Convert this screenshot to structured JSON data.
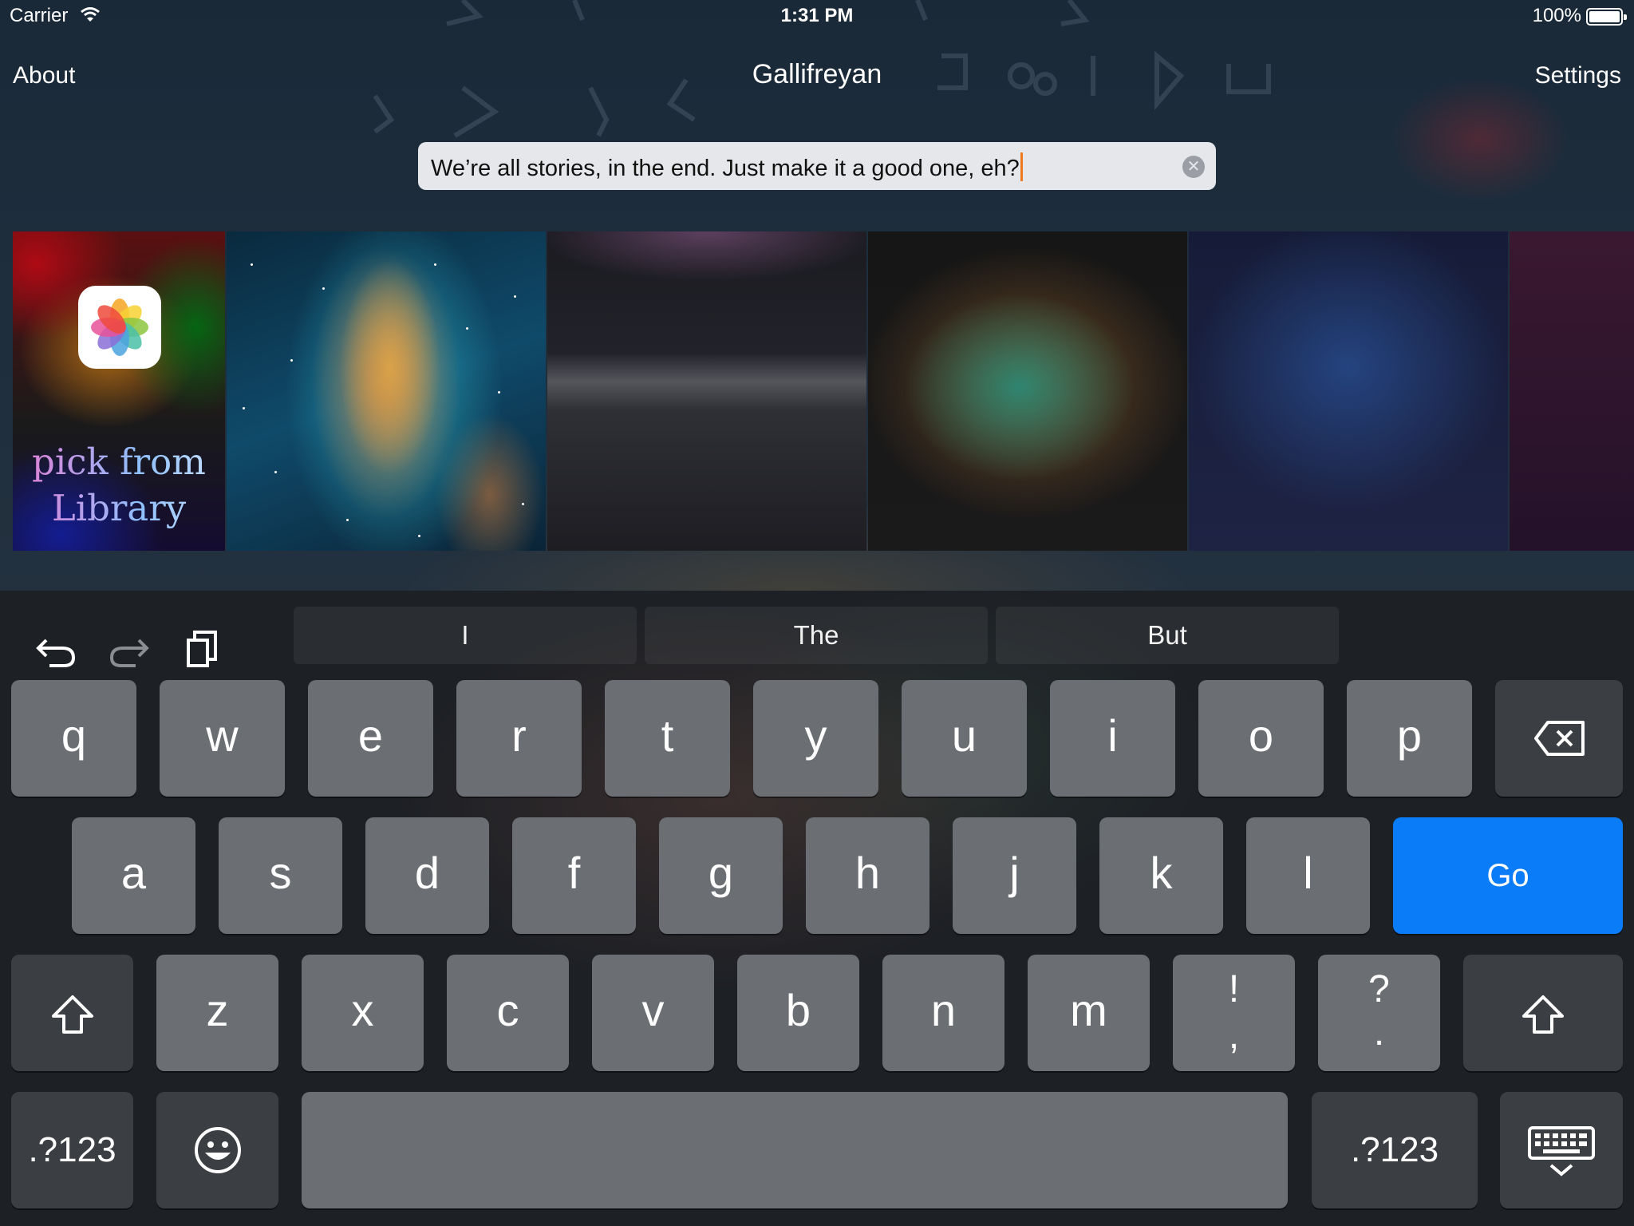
{
  "status_bar": {
    "carrier": "Carrier",
    "time": "1:31 PM",
    "battery": "100%"
  },
  "nav": {
    "left_button": "About",
    "title": "Gallifreyan",
    "right_button": "Settings"
  },
  "search": {
    "value": "We’re all stories, in the end. Just make it a good one, eh?",
    "clear_icon": "clear-icon"
  },
  "gallery": {
    "library_label_line1": "pick from",
    "library_label_line2": "Library"
  },
  "keyboard": {
    "suggestions": [
      "I",
      "The",
      "But"
    ],
    "row1": [
      "q",
      "w",
      "e",
      "r",
      "t",
      "y",
      "u",
      "i",
      "o",
      "p"
    ],
    "row2": [
      "a",
      "s",
      "d",
      "f",
      "g",
      "h",
      "j",
      "k",
      "l"
    ],
    "row3": [
      "z",
      "x",
      "c",
      "v",
      "b",
      "n",
      "m"
    ],
    "exclaim_top": "!",
    "exclaim_bottom": ",",
    "question_top": "?",
    "question_bottom": ".",
    "go_label": "Go",
    "mode_left": ".?123",
    "mode_right": ".?123",
    "accent_color": "#0a7cf7"
  }
}
